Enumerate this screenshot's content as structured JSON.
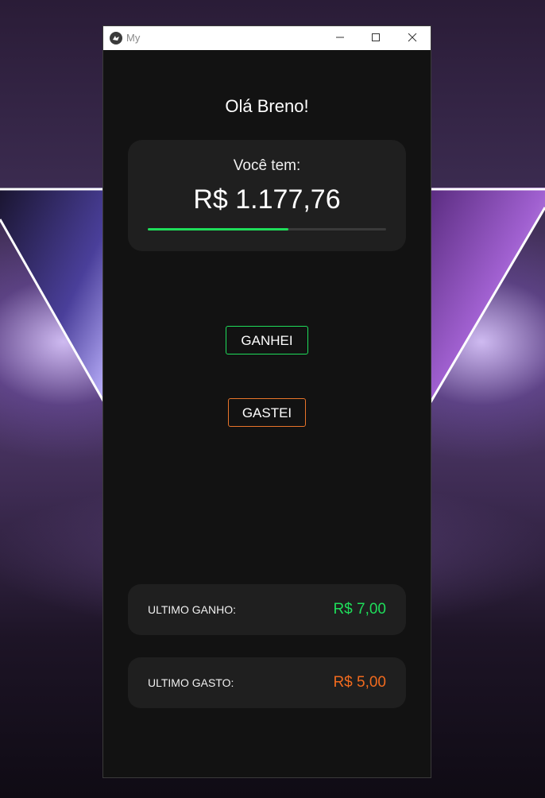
{
  "window": {
    "title": "My",
    "app_icon": "kivy-logo-icon",
    "controls": [
      "minimize-icon",
      "maximize-icon",
      "close-icon"
    ]
  },
  "greeting": "Olá Breno!",
  "balance": {
    "label": "Você tem:",
    "value": "R$ 1.177,76",
    "progress_fraction": 0.59
  },
  "actions": {
    "gain_label": "GANHEI",
    "spend_label": "GASTEI"
  },
  "last_gain": {
    "label": "ULTIMO GANHO:",
    "value": "R$ 7,00"
  },
  "last_spent": {
    "label": "ULTIMO GASTO:",
    "value": "R$ 5,00"
  },
  "colors": {
    "window_bg": "#121212",
    "card_bg": "#1f1f1f",
    "gain_green": "#1fdd5a",
    "spend_orange": "#f06a1e"
  }
}
